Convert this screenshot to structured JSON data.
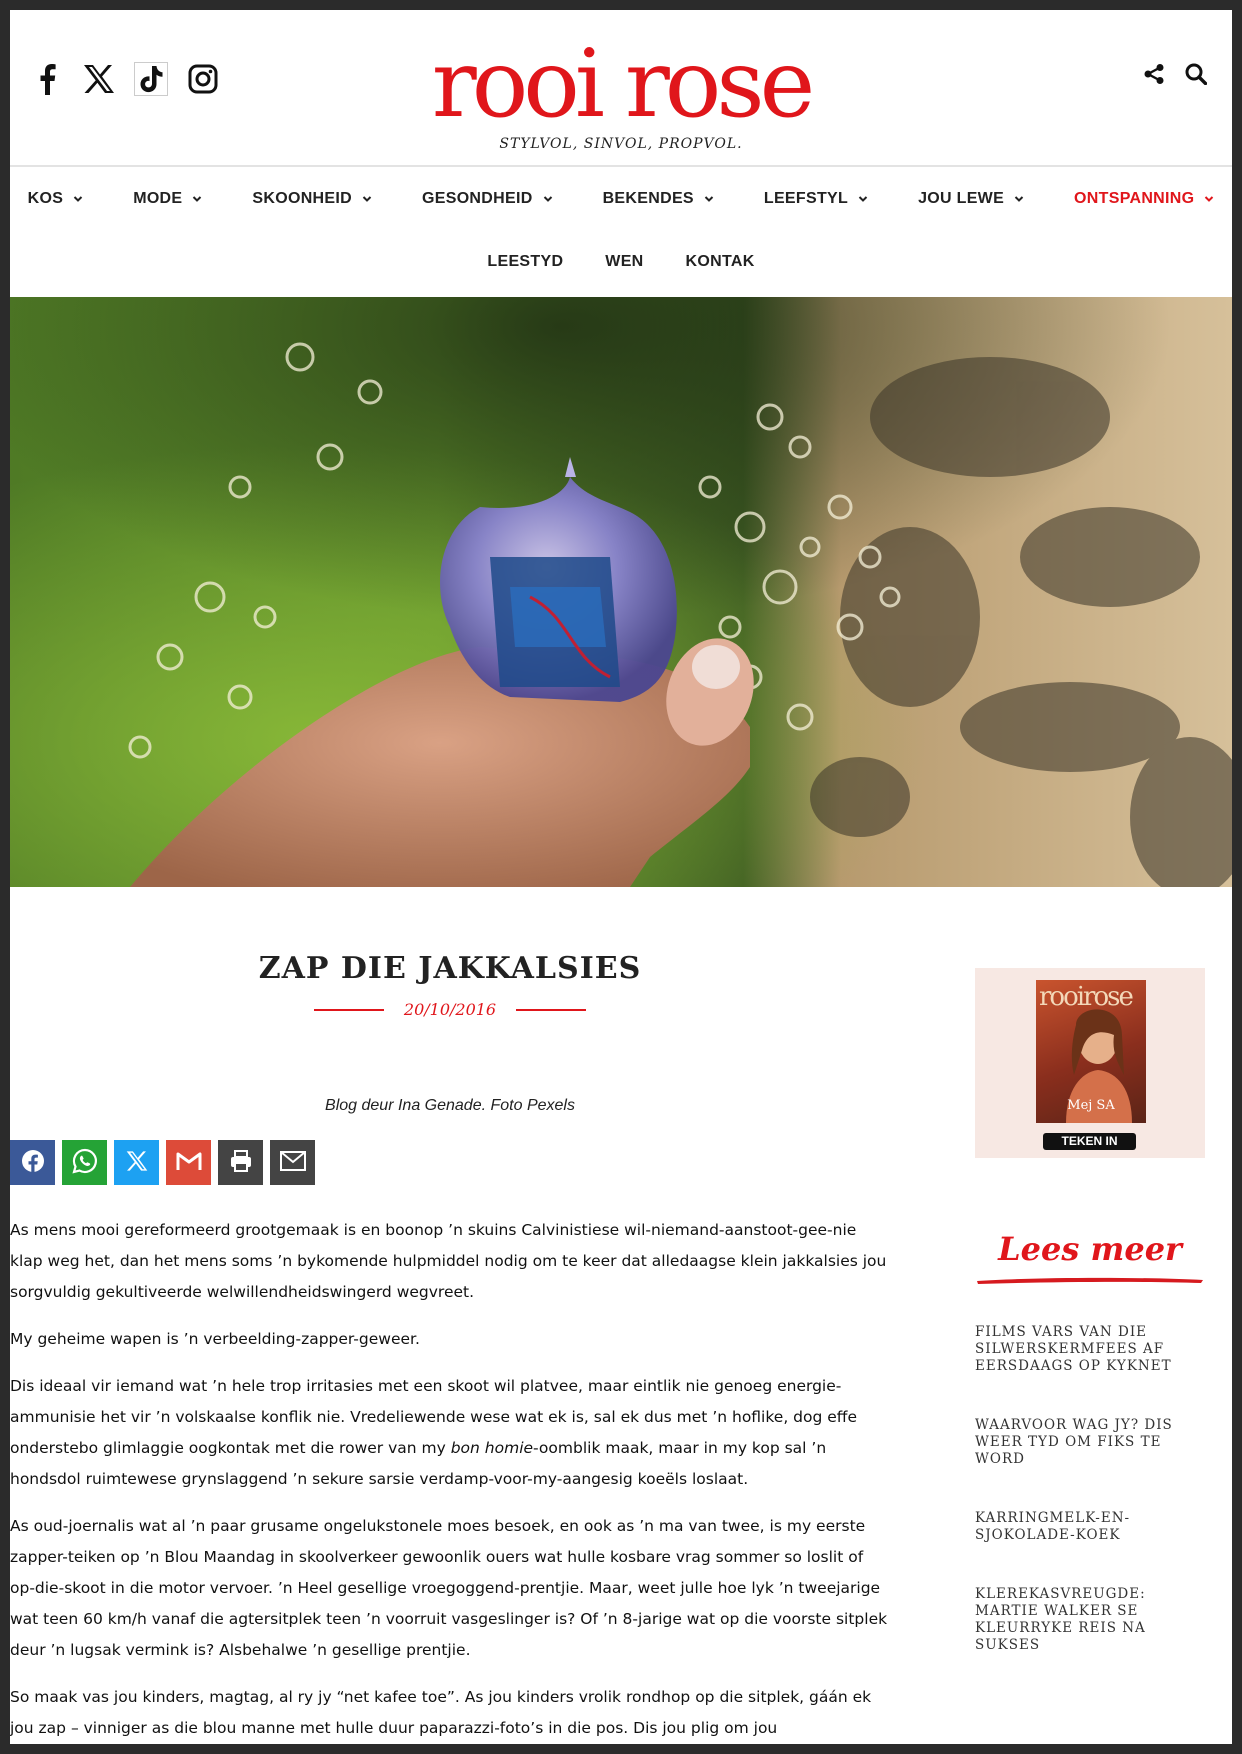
{
  "header": {
    "logo_text": "rooi rose",
    "tagline": "STYLVOL, SINVOL, PROPVOL.",
    "social_icons": [
      "facebook-icon",
      "x-icon",
      "tiktok-icon",
      "instagram-icon"
    ],
    "tool_icons": [
      "share-icon",
      "search-icon"
    ]
  },
  "nav": {
    "row1": [
      {
        "label": "KOS",
        "has_dropdown": true
      },
      {
        "label": "MODE",
        "has_dropdown": true
      },
      {
        "label": "SKOONHEID",
        "has_dropdown": true
      },
      {
        "label": "GESONDHEID",
        "has_dropdown": true
      },
      {
        "label": "BEKENDES",
        "has_dropdown": true
      },
      {
        "label": "LEEFSTYL",
        "has_dropdown": true
      },
      {
        "label": "JOU LEWE",
        "has_dropdown": true
      },
      {
        "label": "ONTSPANNING",
        "has_dropdown": true,
        "active": true
      }
    ],
    "row2": [
      {
        "label": "LEESTYD"
      },
      {
        "label": "WEN"
      },
      {
        "label": "KONTAK"
      }
    ]
  },
  "article": {
    "title": "ZAP DIE JAKKALSIES",
    "date": "20/10/2016",
    "caption": "Blog deur Ina Genade. Foto Pexels",
    "share_buttons": [
      {
        "name": "facebook",
        "color": "#3b5998"
      },
      {
        "name": "whatsapp",
        "color": "#25a336"
      },
      {
        "name": "x",
        "color": "#1da1f2"
      },
      {
        "name": "gmail",
        "color": "#dd4b39"
      },
      {
        "name": "print",
        "color": "#444444"
      },
      {
        "name": "email",
        "color": "#444444"
      }
    ],
    "paragraphs": [
      {
        "text": "As mens mooi gereformeerd grootgemaak is en boonop ’n skuins Calvinistiese wil-niemand-aanstoot-gee-nie klap weg het, dan het mens soms ’n bykomende hulpmiddel nodig om te keer dat alledaagse klein jakkalsies jou sorgvuldig gekultiveerde welwillendheidswingerd wegvreet."
      },
      {
        "text": "My geheime wapen is ’n verbeelding-zapper-geweer."
      },
      {
        "before": "Dis ideaal vir iemand wat ’n hele trop irritasies met een skoot wil platvee, maar eintlik nie genoeg energie-ammunisie het vir ’n volskaalse konflik nie. Vredeliewende wese wat ek is, sal ek dus met ’n hoflike, dog effe onderstebo glimlaggie oogkontak met die rower van my ",
        "italic": "bon homie",
        "after": "-oomblik maak, maar in my kop sal ’n hondsdol ruimtewese grynslaggend ’n sekure sarsie verdamp-voor-my-aangesig koeëls loslaat."
      },
      {
        "text": "As oud-joernalis wat al ’n paar grusame ongelukstonele moes besoek, en ook as ’n ma van twee, is my eerste zapper-teiken op ’n Blou Maandag in skoolverkeer gewoonlik ouers wat hulle kosbare vrag sommer so loslit of op-die-skoot in die motor vervoer. ’n Heel gesellige vroegoggend-prentjie. Maar, weet julle hoe lyk ’n tweejarige wat teen 60 km/h vanaf die agtersitplek teen ’n voorruit vasgeslinger is? Of ’n 8-jarige wat op die voorste sitplek deur ’n lugsak vermink is? Alsbehalwe ’n gesellige prentjie."
      },
      {
        "text": "So maak vas jou kinders, magtag, al ry jy “net kafee toe”. As jou kinders vrolik rondhop op die sitplek, gáán ek jou zap – vinniger as die blou manne met hulle duur paparazzi-foto’s in die pos. Dis jou plig om jou"
      }
    ]
  },
  "sidebar": {
    "ad": {
      "magazine_title": "rooirose",
      "cover_name": "Mej SA",
      "subscribe_label": "TEKEN IN"
    },
    "lees_meer_title": "Lees meer",
    "read_more": [
      "FILMS VARS VAN DIE SILWERSKERMFEES AF EERSDAAGS OP KYKNET",
      "WAARVOOR WAG JY? DIS WEER TYD OM FIKS TE WORD",
      "KARRINGMELK-EN-SJOKOLADE-KOEK",
      "KLEREKASVREUGDE: MARTIE WALKER SE KLEURRYKE REIS NA SUKSES"
    ]
  },
  "colors": {
    "brand_red": "#e0161b",
    "frame": "#2b2b2b",
    "ad_bg": "#f7e8e3"
  }
}
